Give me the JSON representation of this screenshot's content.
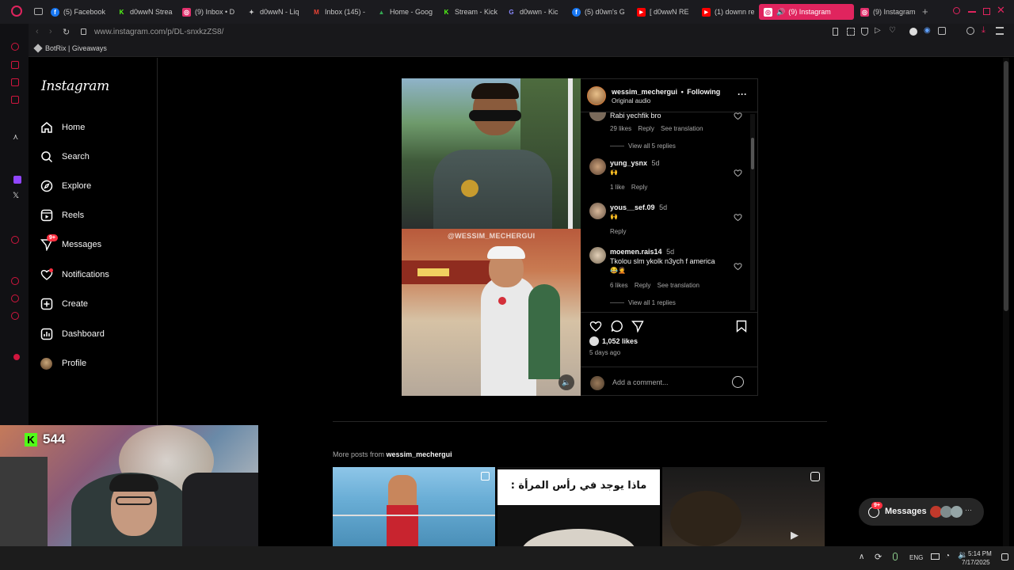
{
  "browser": {
    "tabs": [
      {
        "label": "(5) Facebook",
        "color": "#1877f2",
        "glyph": "f"
      },
      {
        "label": "d0wwN Strea",
        "color": "#53fc18",
        "glyph": "K"
      },
      {
        "label": "(9) Inbox • D",
        "color": "#e1306c",
        "glyph": "◎"
      },
      {
        "label": "d0wwN - Liq",
        "color": "#bbbbbb",
        "glyph": "✦"
      },
      {
        "label": "Inbox (145) -",
        "color": "#ea4335",
        "glyph": "M"
      },
      {
        "label": "Home - Goog",
        "color": "#34a853",
        "glyph": "▲"
      },
      {
        "label": "Stream - Kick",
        "color": "#53fc18",
        "glyph": "K"
      },
      {
        "label": "d0wwn - Kic",
        "color": "#8888ff",
        "glyph": "G"
      },
      {
        "label": "(5) d0wn's G",
        "color": "#1877f2",
        "glyph": "f"
      },
      {
        "label": "[ d0wwN RE",
        "color": "#ff0000",
        "glyph": "▶"
      },
      {
        "label": "(1) downn re",
        "color": "#ff0000",
        "glyph": "▶"
      },
      {
        "label": "(9) Instagram",
        "color": "#e1306c",
        "glyph": "◎"
      },
      {
        "label": "(9) Instagram",
        "color": "#e1306c",
        "glyph": "◎"
      }
    ],
    "url": "www.instagram.com/p/DL-snxkzZS8/",
    "bookmark": "BotRix | Giveaways"
  },
  "nav": {
    "logo": "Instagram",
    "items": [
      "Home",
      "Search",
      "Explore",
      "Reels",
      "Messages",
      "Notifications",
      "Create",
      "Dashboard",
      "Profile"
    ],
    "messages_badge": "9+"
  },
  "post": {
    "username": "wessim_mechergui",
    "separator": "•",
    "follow_state": "Following",
    "audio": "Original audio",
    "watermark": "@WESSIM_MECHERGUI",
    "likes": "1,052 likes",
    "age": "5 days ago",
    "comment_placeholder": "Add a comment...",
    "comments": [
      {
        "text": "Rabi yechfik bro",
        "likes": "29 likes",
        "reply": "Reply",
        "translate": "See translation",
        "view_replies": "View all 5 replies"
      },
      {
        "user": "yung_ysnx",
        "time": "5d",
        "text": "🙌",
        "likes": "1 like",
        "reply": "Reply"
      },
      {
        "user": "yous__sef.09",
        "time": "5d",
        "text": "🙌",
        "reply": "Reply"
      },
      {
        "user": "moemen.rais14",
        "time": "5d",
        "text": "Tkolou slm ykolk n3ych f america",
        "emoji": "😂🤦",
        "likes": "6 likes",
        "reply": "Reply",
        "translate": "See translation",
        "view_replies": "View all 1 replies"
      }
    ]
  },
  "more_posts": {
    "label": "More posts from",
    "user": "wessim_mechergui",
    "thumb_text": "ماذا يوجد في رأس المرأة :"
  },
  "overlay": {
    "viewer_count": "544",
    "messages_label": "Messages",
    "messages_badge": "9+"
  },
  "taskbar": {
    "lang": "ENG",
    "time": "5:14 PM",
    "date": "7/17/2025"
  },
  "colors": {
    "instagram_accent": "#e0245e",
    "kick_green": "#53fc18",
    "badge_red": "#ff3040"
  }
}
